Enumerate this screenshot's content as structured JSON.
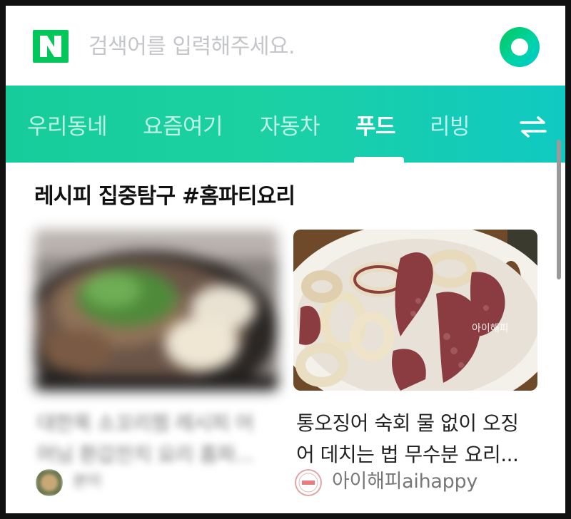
{
  "header": {
    "logo_letter": "N",
    "search_placeholder": "검색어를 입력해주세요.",
    "brand_color": "#03c75a"
  },
  "tabs": {
    "items": [
      {
        "label": "우리동네",
        "active": false
      },
      {
        "label": "요즘여기",
        "active": false
      },
      {
        "label": "자동차",
        "active": false
      },
      {
        "label": "푸드",
        "active": true
      },
      {
        "label": "리빙",
        "active": false
      }
    ],
    "menu_icon": "swap-arrows-icon"
  },
  "section": {
    "title": "레시피 집중탐구 #홈파티요리"
  },
  "cards": [
    {
      "title": "대한목 소꼬리찜 레시피 어\n머님 환갑잔치 요리 홈파...",
      "author": "본이",
      "blurred": true
    },
    {
      "title": "통오징어 숙회 물 없이 오징\n어 데치는 법 무수분 요리...",
      "author": "아이해피aihappy",
      "watermark": "아이해피",
      "blurred": false
    }
  ]
}
